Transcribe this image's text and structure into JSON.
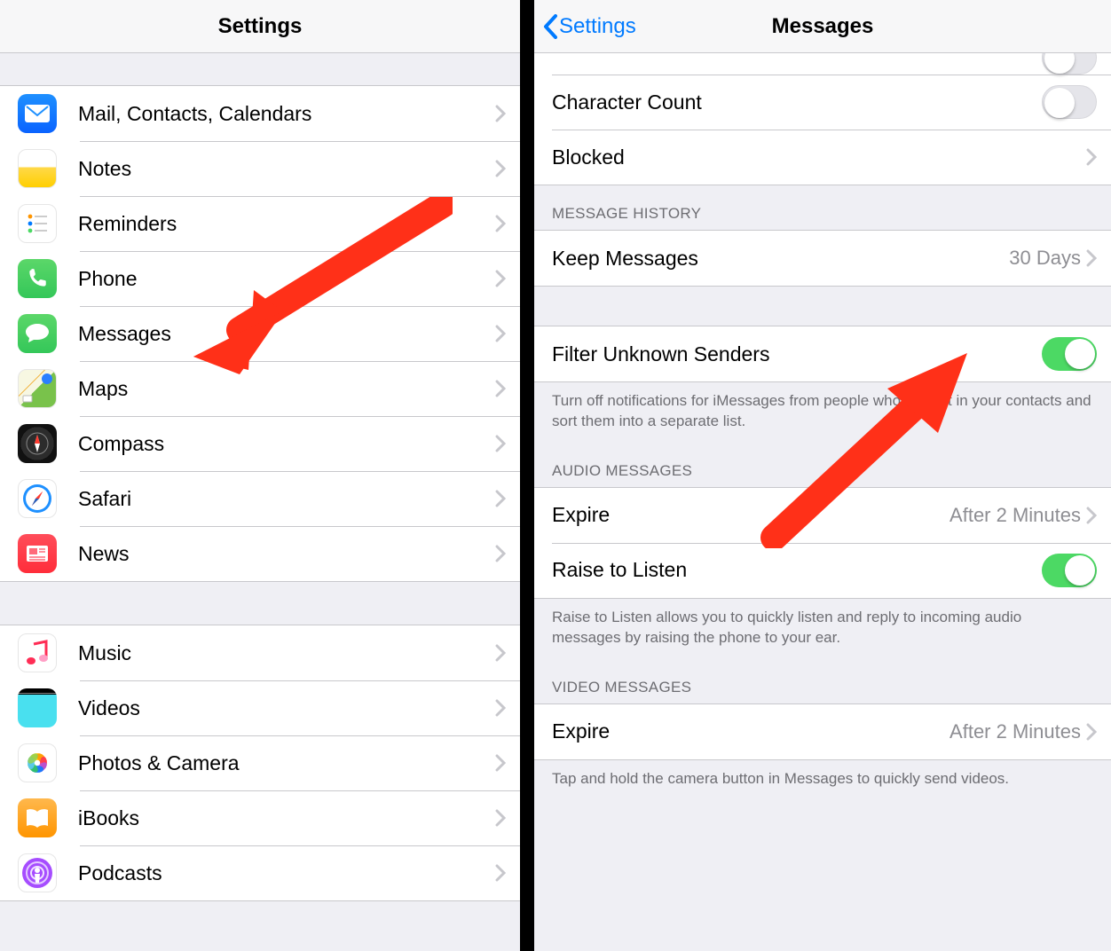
{
  "left": {
    "title": "Settings",
    "group1": [
      {
        "label": "Mail, Contacts, Calendars",
        "icon": "mail-icon"
      },
      {
        "label": "Notes",
        "icon": "notes-icon"
      },
      {
        "label": "Reminders",
        "icon": "reminders-icon"
      },
      {
        "label": "Phone",
        "icon": "phone-icon"
      },
      {
        "label": "Messages",
        "icon": "messages-icon"
      },
      {
        "label": "Maps",
        "icon": "maps-icon"
      },
      {
        "label": "Compass",
        "icon": "compass-icon"
      },
      {
        "label": "Safari",
        "icon": "safari-icon"
      },
      {
        "label": "News",
        "icon": "news-icon"
      }
    ],
    "group2": [
      {
        "label": "Music",
        "icon": "music-icon"
      },
      {
        "label": "Videos",
        "icon": "videos-icon"
      },
      {
        "label": "Photos & Camera",
        "icon": "photos-icon"
      },
      {
        "label": "iBooks",
        "icon": "ibooks-icon"
      },
      {
        "label": "Podcasts",
        "icon": "podcasts-icon"
      }
    ]
  },
  "right": {
    "back": "Settings",
    "title": "Messages",
    "topRows": {
      "charCount": "Character Count",
      "blocked": "Blocked"
    },
    "history": {
      "header": "MESSAGE HISTORY",
      "keep": {
        "label": "Keep Messages",
        "value": "30 Days"
      }
    },
    "filter": {
      "label": "Filter Unknown Senders",
      "footer": "Turn off notifications for iMessages from people who are not in your contacts and sort them into a separate list."
    },
    "audio": {
      "header": "AUDIO MESSAGES",
      "expire": {
        "label": "Expire",
        "value": "After 2 Minutes"
      },
      "raise": "Raise to Listen",
      "footer": "Raise to Listen allows you to quickly listen and reply to incoming audio messages by raising the phone to your ear."
    },
    "video": {
      "header": "VIDEO MESSAGES",
      "expire": {
        "label": "Expire",
        "value": "After 2 Minutes"
      },
      "footer": "Tap and hold the camera button in Messages to quickly send videos."
    }
  },
  "annotations": {
    "arrow_color": "#ff3018"
  }
}
